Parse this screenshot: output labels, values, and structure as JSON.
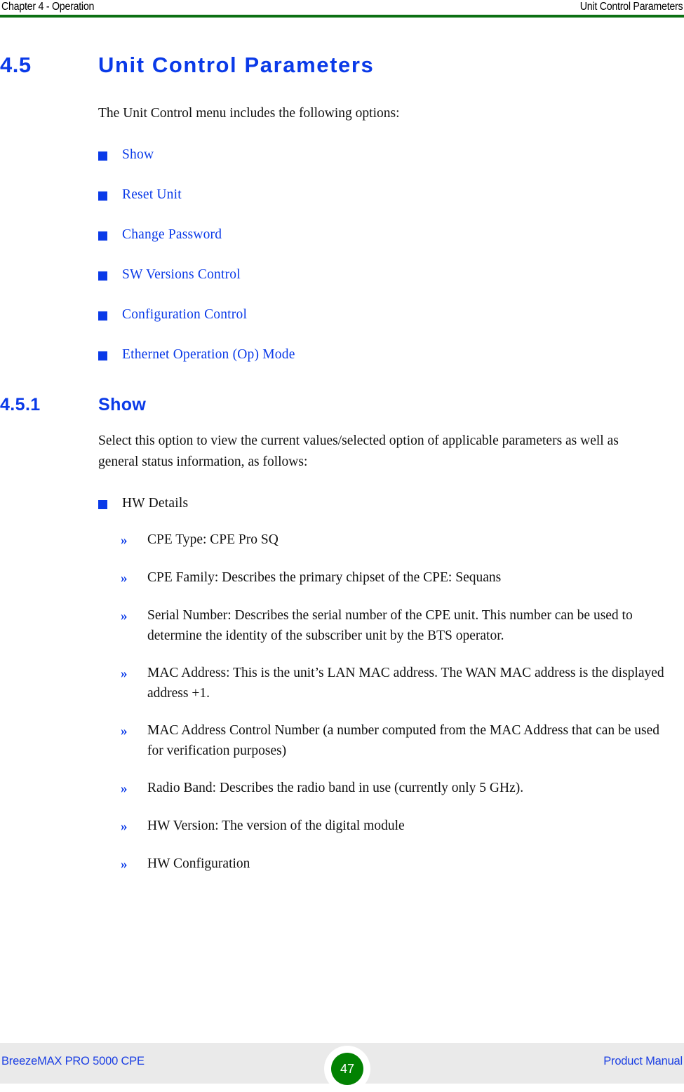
{
  "header": {
    "left": "Chapter 4 - Operation",
    "right": "Unit Control Parameters",
    "rule_color": "#0c7013"
  },
  "section": {
    "number": "4.5",
    "title": "Unit Control Parameters",
    "intro": "The Unit Control menu includes the following options:",
    "menu_options": [
      {
        "label": "Show"
      },
      {
        "label": "Reset Unit"
      },
      {
        "label": "Change Password"
      },
      {
        "label": "SW Versions Control"
      },
      {
        "label": "Configuration Control"
      },
      {
        "label": "Ethernet Operation (Op) Mode"
      }
    ]
  },
  "subsection": {
    "number": "4.5.1",
    "title": "Show",
    "intro": "Select this option to view the current values/selected option of applicable parameters as well as general status information, as follows:",
    "group_label": "HW Details",
    "details": [
      {
        "text": "CPE Type: CPE Pro SQ"
      },
      {
        "text": "CPE Family: Describes the primary chipset of the CPE: Sequans"
      },
      {
        "text": "Serial Number: Describes the serial number of the CPE unit. This number can be used to determine the identity of the subscriber unit by the BTS operator."
      },
      {
        "text": "MAC Address: This is the unit’s LAN MAC address. The WAN MAC address is the displayed address +1."
      },
      {
        "text": "MAC Address Control Number (a number computed from the MAC Address that can be used for verification purposes)"
      },
      {
        "text": "Radio Band: Describes the radio band in use (currently only 5 GHz)."
      },
      {
        "text": "HW Version: The version of the digital module"
      },
      {
        "text": "HW Configuration"
      }
    ]
  },
  "footer": {
    "left": "BreezeMAX PRO 5000 CPE",
    "page_number": "47",
    "right": "Product Manual",
    "badge_color": "#028202"
  },
  "colors": {
    "heading_blue": "#0a3ae8",
    "link_blue": "#0a3ae8",
    "footer_blue": "#1b3fe3",
    "rule_green": "#0c7013",
    "body_black": "#101010",
    "footer_bg": "#eaeaea"
  }
}
